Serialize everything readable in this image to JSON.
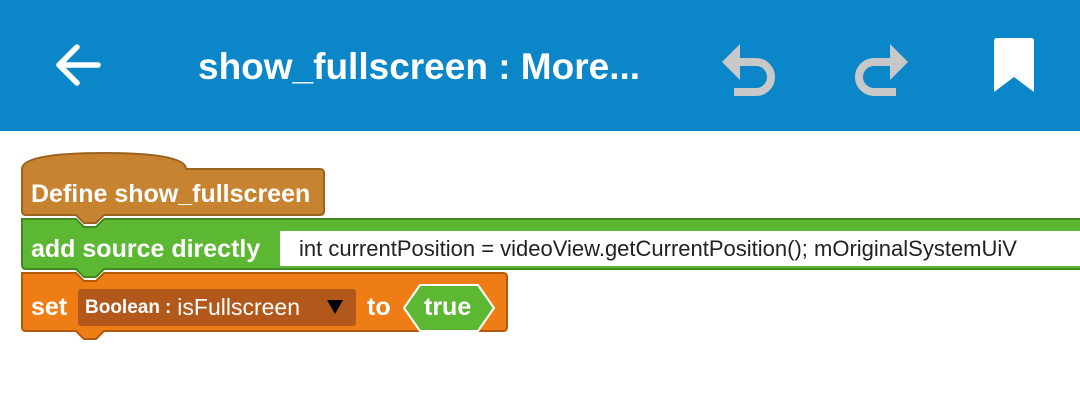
{
  "app_bar": {
    "title": "show_fullscreen : More...",
    "background_color": "#0a86c9",
    "icons": [
      "back-arrow-icon",
      "undo-icon",
      "redo-icon",
      "bookmark-icon"
    ]
  },
  "blocks": {
    "define": {
      "label": "Define show_fullscreen",
      "color": "#c88330"
    },
    "add_source": {
      "label": "add source directly",
      "code": "int currentPosition = videoView.getCurrentPosition(); mOriginalSystemUiV",
      "color": "#5cb832"
    },
    "set_var": {
      "label_set": "set",
      "var_type": "Boolean",
      "var_separator": ":",
      "var_name": "isFullscreen",
      "label_to": "to",
      "value": "true",
      "color": "#ee7d16",
      "value_color": "#5cb832"
    }
  }
}
